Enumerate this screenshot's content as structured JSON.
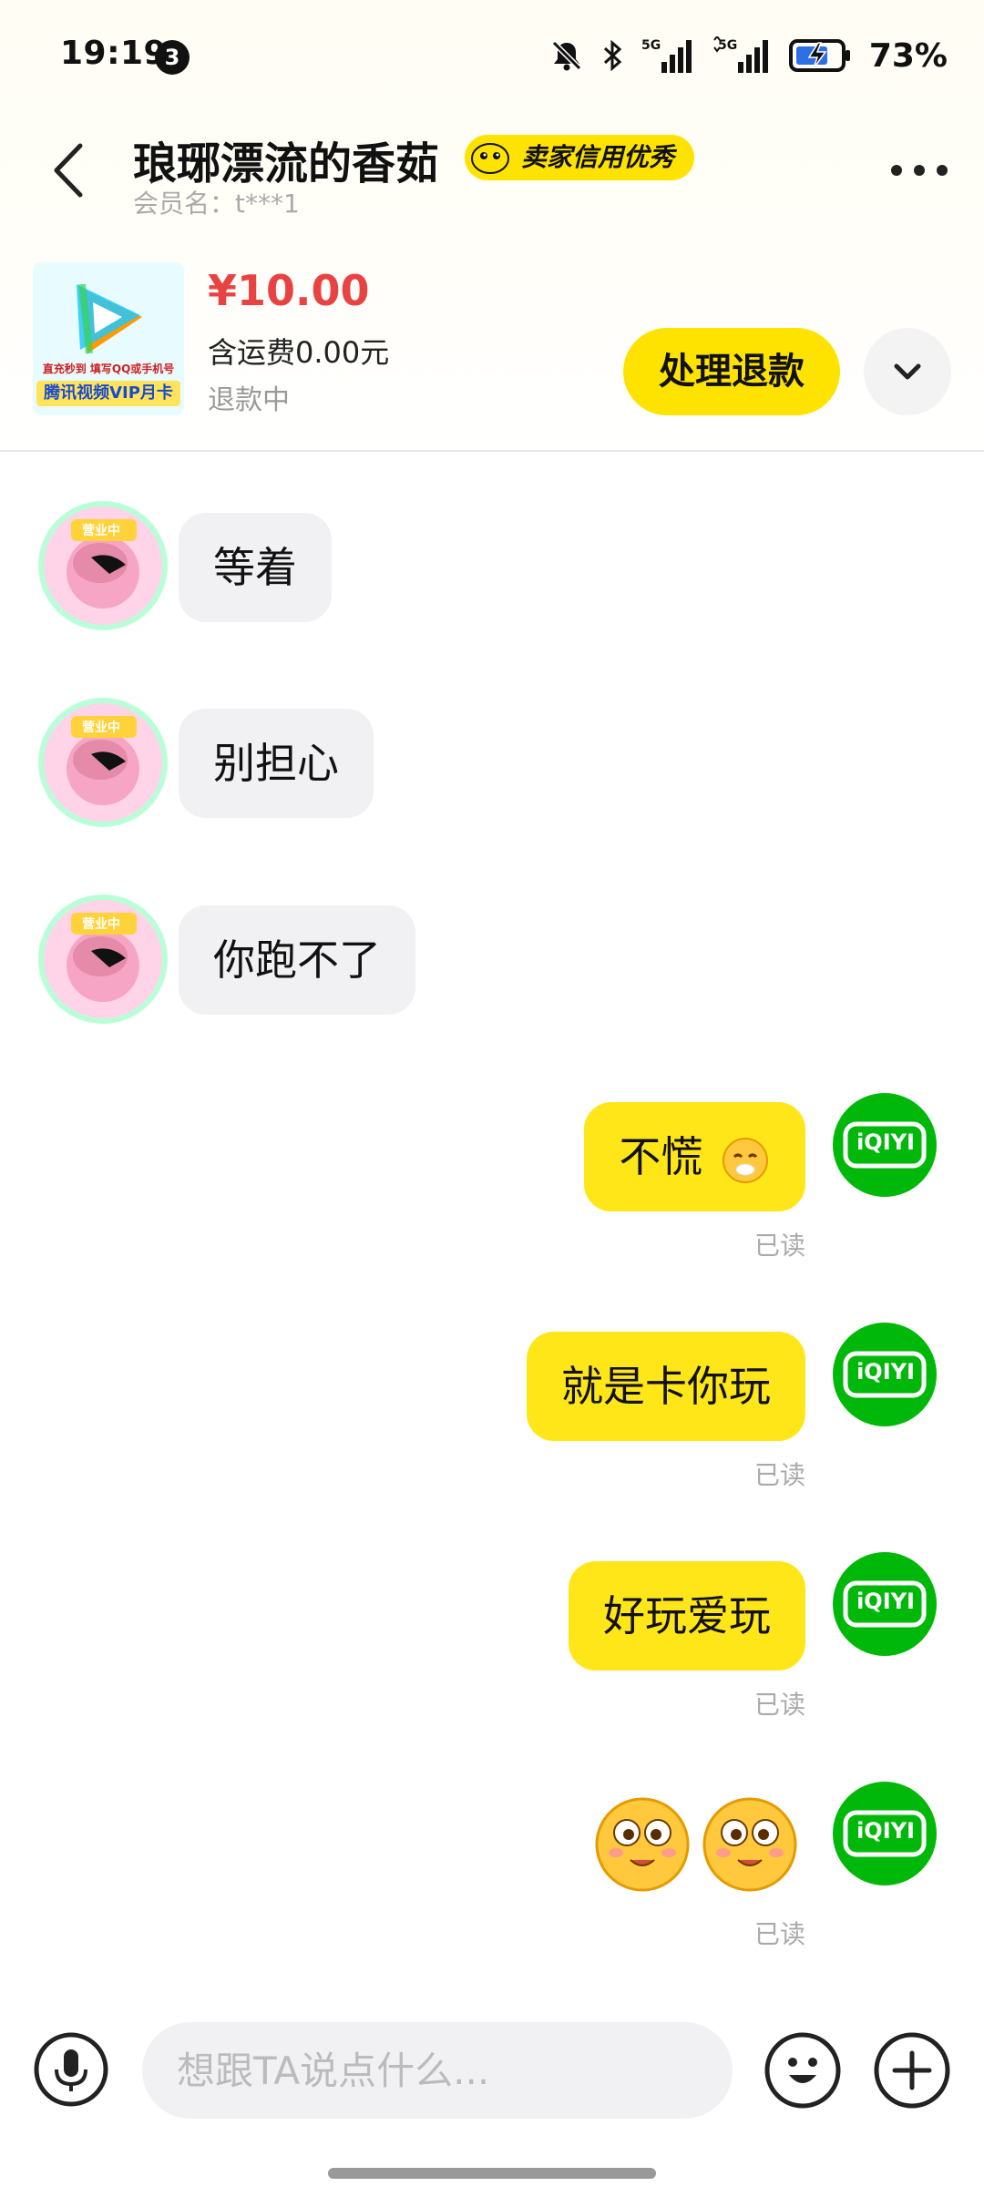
{
  "status_bar": {
    "time": "19:19",
    "notification_count": "3",
    "battery_percent": "73%",
    "icons": [
      "mute-bell-icon",
      "bluetooth-icon",
      "signal-5g-icon",
      "signal-5g-icon",
      "battery-charging-icon"
    ]
  },
  "header": {
    "seller_name": "琅琊漂流的香茹",
    "credit_badge": "卖家信用优秀",
    "member_name": "会员名：t***1"
  },
  "product": {
    "thumb_caption_1": "直充秒到 填写QQ或手机号",
    "thumb_caption_2": "腾讯视频VIP月卡",
    "price": "¥10.00",
    "shipping": "含运费0.00元",
    "status": "退款中",
    "action_button": "处理退款"
  },
  "messages": [
    {
      "side": "in",
      "text": "等着"
    },
    {
      "side": "in",
      "text": "别担心"
    },
    {
      "side": "in",
      "text": "你跑不了"
    },
    {
      "side": "out",
      "text": "不慌",
      "read": "已读"
    },
    {
      "side": "out",
      "text": "就是卡你玩",
      "read": "已读"
    },
    {
      "side": "out",
      "text": "好玩爱玩",
      "read": "已读"
    },
    {
      "side": "out",
      "text": "",
      "read": "已读"
    }
  ],
  "my_avatar_text": "iQIYI",
  "seller_avatar_text": "营业中",
  "input": {
    "placeholder": "想跟TA说点什么..."
  },
  "colors": {
    "accent_yellow": "#ffe300",
    "price_red": "#e84343",
    "iqiyi_green": "#00b80a"
  }
}
